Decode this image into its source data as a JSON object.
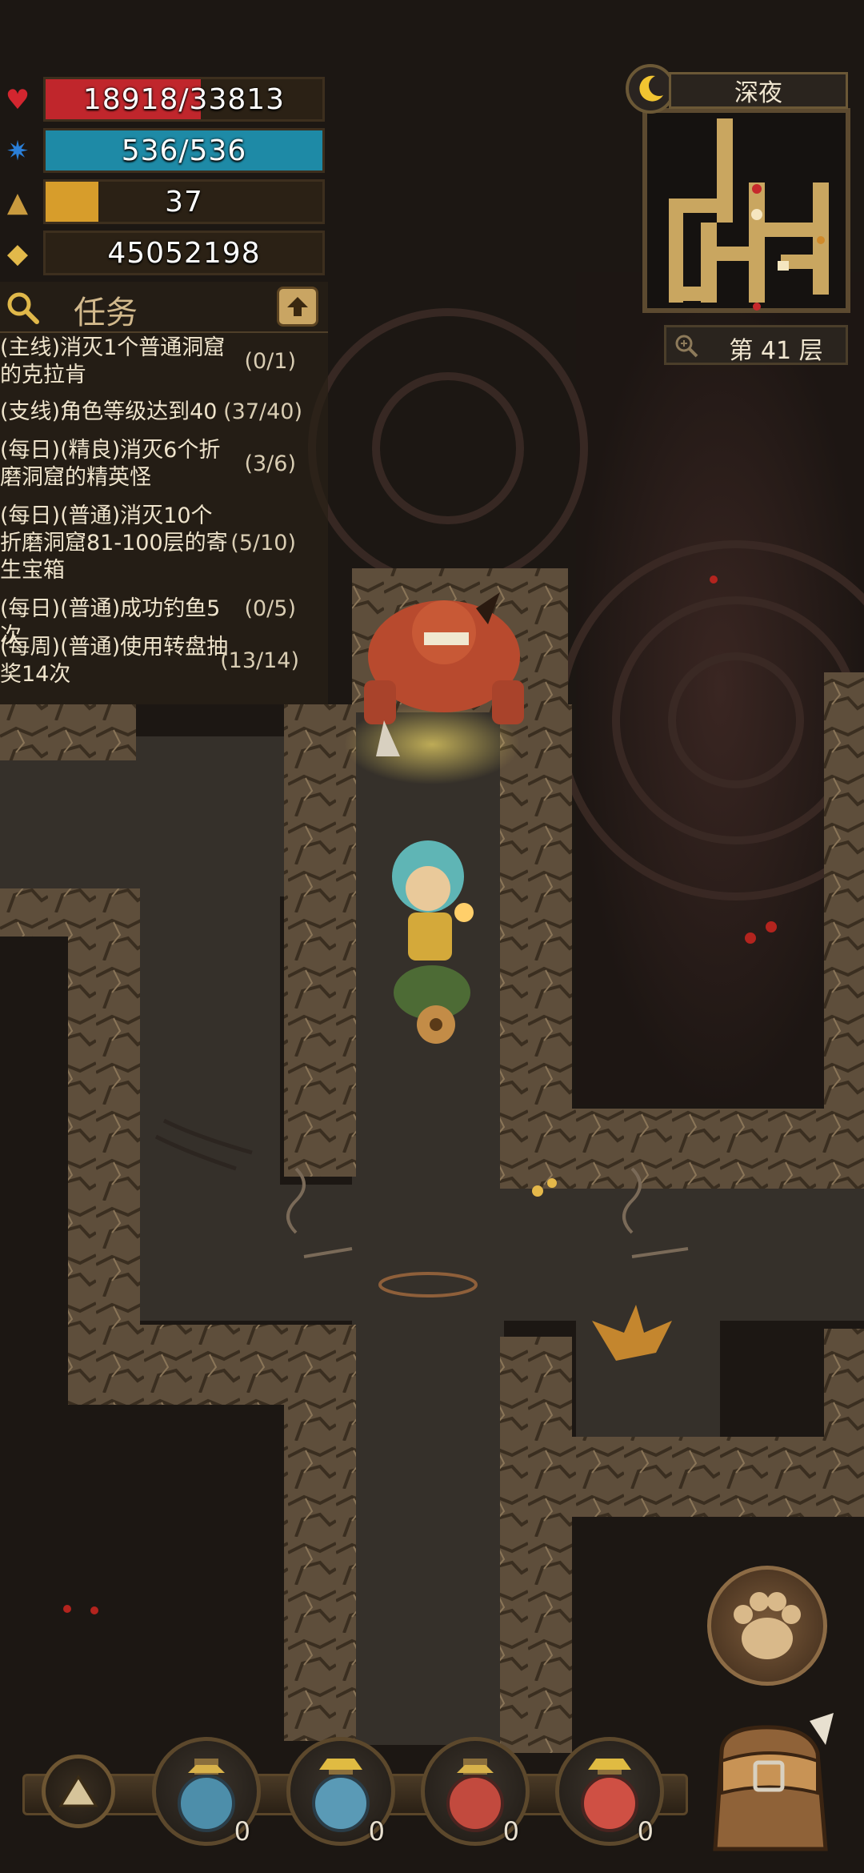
{
  "stats": {
    "hp": {
      "text": "18918/33813",
      "fraction": 0.56,
      "color": "#c0262c",
      "icon": "heart-icon"
    },
    "mp": {
      "text": "536/536",
      "fraction": 1.0,
      "color": "#1e8aa6",
      "icon": "mana-icon"
    },
    "level": {
      "text": "37",
      "fraction": 0.19,
      "color": "#d79d2b",
      "icon": "level-triangle-icon"
    },
    "gold": {
      "text": "45052198",
      "icon": "gold-icon"
    }
  },
  "quests": {
    "title": "任务",
    "items": [
      {
        "text": "(主线)消灭1个普通洞窟的克拉肯",
        "progress": "(0/1)"
      },
      {
        "text": "(支线)角色等级达到40",
        "progress": "(37/40)"
      },
      {
        "text": "(每日)(精良)消灭6个折磨洞窟的精英怪",
        "progress": "(3/6)"
      },
      {
        "text": "(每日)(普通)消灭10个折磨洞窟81-100层的寄生宝箱",
        "progress": "(5/10)"
      },
      {
        "text": "(每日)(普通)成功钓鱼5次",
        "progress": "(0/5)"
      },
      {
        "text": "(每周)(普通)使用转盘抽奖14次",
        "progress": "(13/14)"
      }
    ]
  },
  "minimap": {
    "time_of_day": "深夜",
    "floor": "第 41 层"
  },
  "hotbar": {
    "slots": [
      {
        "item": "blue-potion-icon",
        "count": "0"
      },
      {
        "item": "blue-potion-icon",
        "count": "0"
      },
      {
        "item": "red-potion-icon",
        "count": "0"
      },
      {
        "item": "red-potion-icon",
        "count": "0"
      }
    ]
  },
  "colors": {
    "hp": "#c0262c",
    "mp": "#1e8aa6",
    "xp": "#d79d2b",
    "panel": "#2b2115",
    "rock": "#6b5a44"
  }
}
